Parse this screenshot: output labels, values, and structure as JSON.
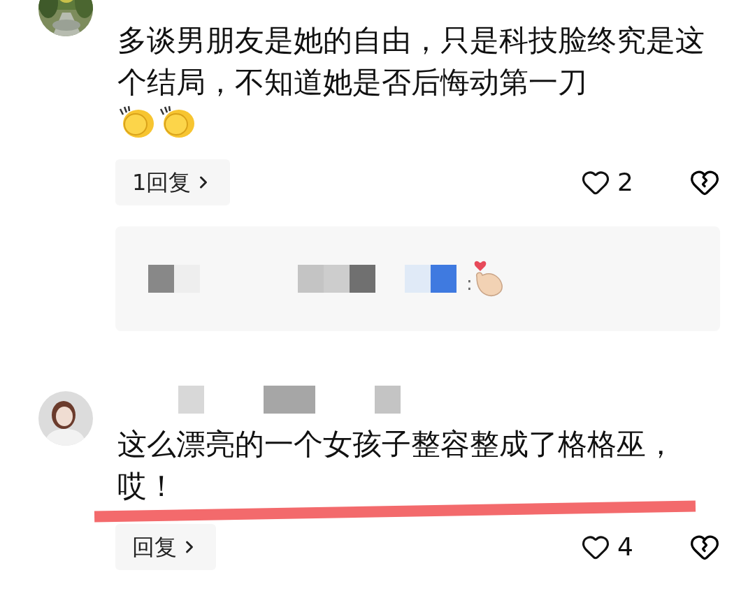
{
  "comments": [
    {
      "text": "多谈男朋友是她的自由，只是科技脸终究是这个结局，不知道她是否后悔动第一刀",
      "emojis": [
        {
          "kind": "clap"
        },
        {
          "kind": "clap"
        }
      ],
      "reply_button": "1回复",
      "likes": "2",
      "highlighted": false,
      "reply_preview": {
        "separator": ":",
        "emojis": [
          {
            "kind": "finger_heart"
          }
        ]
      }
    },
    {
      "avatar": {
        "kind": "person"
      },
      "text": "这么漂亮的一个女孩子整容整成了格格巫，哎！",
      "reply_button": "回复",
      "likes": "4",
      "highlighted": true
    }
  ]
}
